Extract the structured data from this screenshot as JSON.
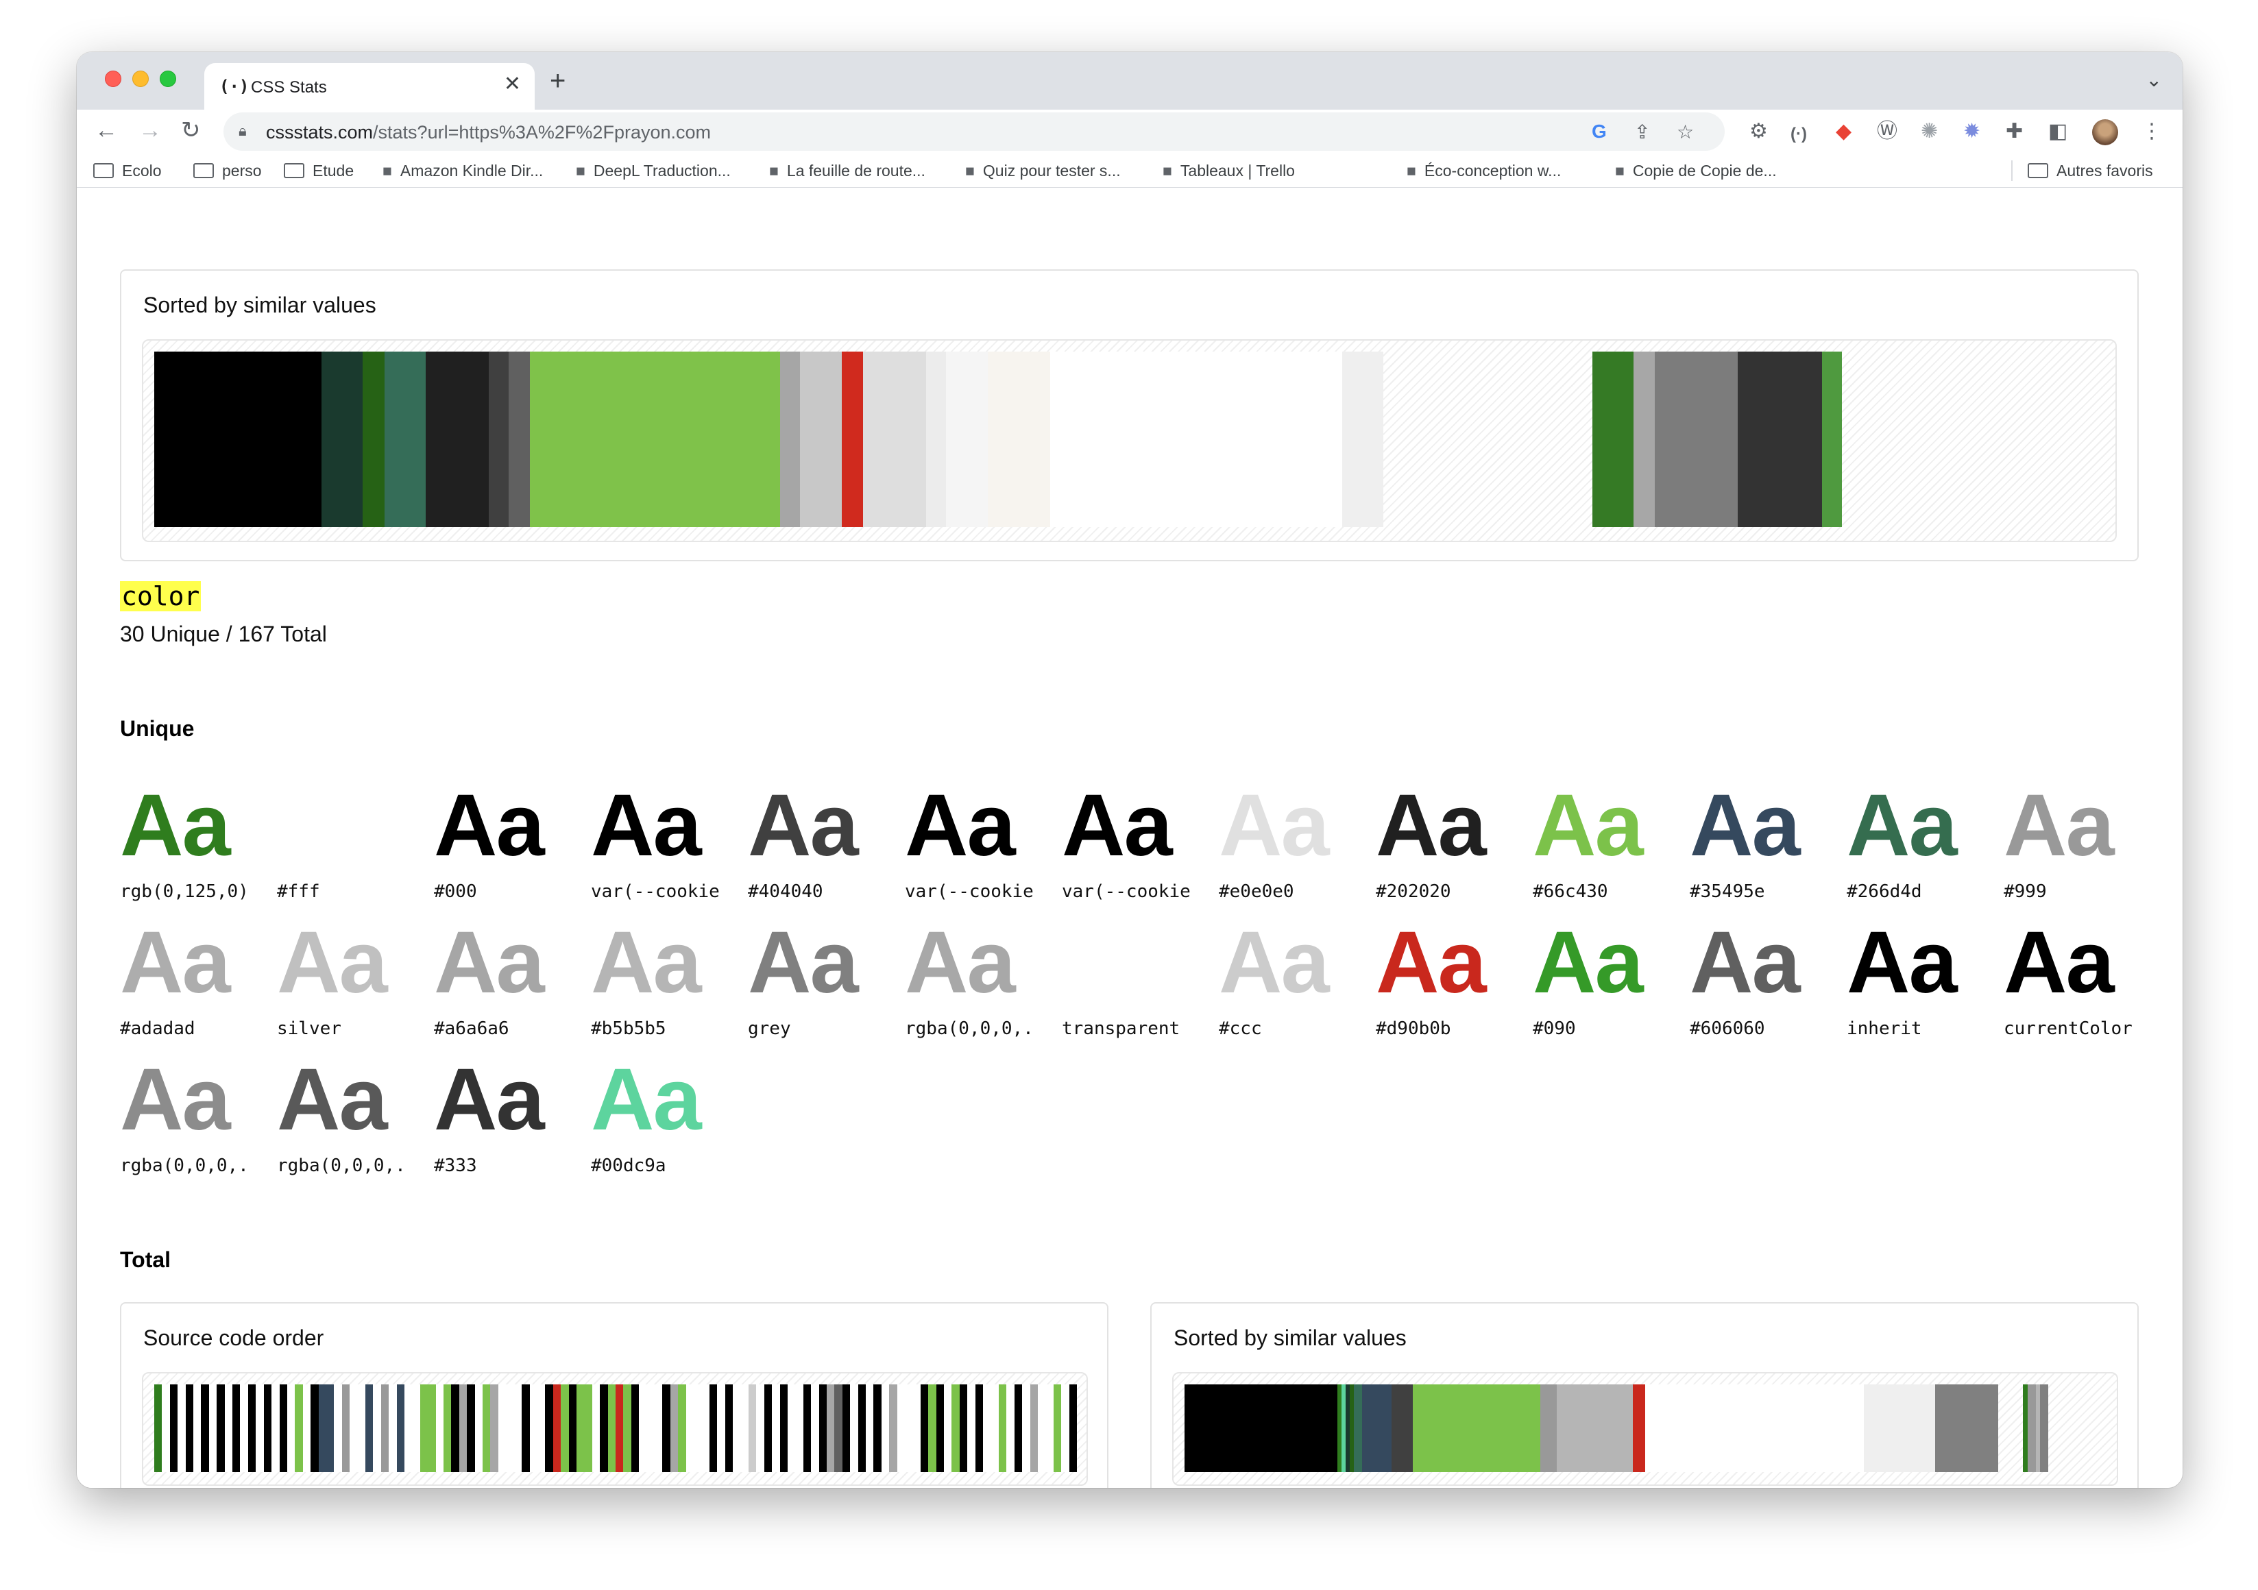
{
  "browser": {
    "tab_title": "CSS Stats",
    "tab_favicon": "(·)",
    "close_glyph": "✕",
    "newtab_glyph": "+",
    "url_host": "cssstats.com",
    "url_rest": "/stats?url=https%3A%2F%2Fprayon.com",
    "bookmarks": [
      {
        "label": "Ecolo",
        "icon": "folder-icon"
      },
      {
        "label": "perso",
        "icon": "folder-icon"
      },
      {
        "label": "Etude",
        "icon": "folder-icon"
      },
      {
        "label": "Amazon Kindle Dir...",
        "icon": "amazon-icon"
      },
      {
        "label": "DeepL Traduction...",
        "icon": "deepl-icon"
      },
      {
        "label": "La feuille de route...",
        "icon": "app-icon"
      },
      {
        "label": "Quiz pour tester s...",
        "icon": "quiz-icon"
      },
      {
        "label": "Tableaux | Trello",
        "icon": "trello-icon"
      },
      {
        "label": "Éco-conception w...",
        "icon": "slash-icon"
      },
      {
        "label": "Copie de Copie de...",
        "icon": "canva-icon"
      }
    ],
    "other_bookmarks": "Autres favoris"
  },
  "top_card": {
    "title": "Sorted by similar values",
    "strip": [
      {
        "color": "#000000",
        "weight": 117
      },
      {
        "color": "#1a3a2e",
        "weight": 29
      },
      {
        "color": "#266215",
        "weight": 15
      },
      {
        "color": "#356d58",
        "weight": 29
      },
      {
        "color": "#202020",
        "weight": 44
      },
      {
        "color": "#404040",
        "weight": 14
      },
      {
        "color": "#606060",
        "weight": 15
      },
      {
        "color": "#7fc24a",
        "weight": 175
      },
      {
        "color": "#a6a6a6",
        "weight": 14
      },
      {
        "color": "#c8c8c8",
        "weight": 29
      },
      {
        "color": "#d02a1e",
        "weight": 15
      },
      {
        "color": "#dedede",
        "weight": 44
      },
      {
        "color": "#ececec",
        "weight": 14
      },
      {
        "color": "#f5f5f5",
        "weight": 29
      },
      {
        "color": "#f7f4ef",
        "weight": 44
      },
      {
        "color": "#ffffff",
        "weight": 204
      },
      {
        "color": "#efefef",
        "weight": 29
      },
      {
        "color": "transparent",
        "weight": 146
      },
      {
        "color": "#357a25",
        "weight": 29
      },
      {
        "color": "#a7a7a7",
        "weight": 15
      },
      {
        "color": "#7c7c7c",
        "weight": 58
      },
      {
        "color": "#333333",
        "weight": 59
      },
      {
        "color": "#4f9a3f",
        "weight": 14
      },
      {
        "color": "transparent",
        "weight": 184
      }
    ]
  },
  "property": {
    "name": "color",
    "stats": "30 Unique / 167 Total"
  },
  "unique": {
    "heading": "Unique",
    "sample_text": "Aa",
    "items": [
      {
        "label": "rgb(0,125,0)",
        "color": "#2f7d1e"
      },
      {
        "label": "#fff",
        "color": "#ffffff"
      },
      {
        "label": "#000",
        "color": "#000000"
      },
      {
        "label": "var(--cookie",
        "color": "#000000"
      },
      {
        "label": "#404040",
        "color": "#404040"
      },
      {
        "label": "var(--cookie",
        "color": "#000000"
      },
      {
        "label": "var(--cookie",
        "color": "#000000"
      },
      {
        "label": "#e0e0e0",
        "color": "#e0e0e0"
      },
      {
        "label": "#202020",
        "color": "#202020"
      },
      {
        "label": "#66c430",
        "color": "#7cc24a"
      },
      {
        "label": "#35495e",
        "color": "#35495e"
      },
      {
        "label": "#266d4d",
        "color": "#356d4f"
      },
      {
        "label": "#999",
        "color": "#999999"
      },
      {
        "label": "#adadad",
        "color": "#adadad"
      },
      {
        "label": "silver",
        "color": "#c0c0c0"
      },
      {
        "label": "#a6a6a6",
        "color": "#a6a6a6"
      },
      {
        "label": "#b5b5b5",
        "color": "#b5b5b5"
      },
      {
        "label": "grey",
        "color": "#808080"
      },
      {
        "label": "rgba(0,0,0,.",
        "color": "#a8a8a8"
      },
      {
        "label": "transparent",
        "color": "transparent"
      },
      {
        "label": "#ccc",
        "color": "#cccccc"
      },
      {
        "label": "#d90b0b",
        "color": "#c9281d"
      },
      {
        "label": "#090",
        "color": "#359a28"
      },
      {
        "label": "#606060",
        "color": "#606060"
      },
      {
        "label": "inherit",
        "color": "#000000"
      },
      {
        "label": "currentColor",
        "color": "#000000"
      },
      {
        "label": "rgba(0,0,0,.",
        "color": "#8c8c8c"
      },
      {
        "label": "rgba(0,0,0,.",
        "color": "#595959"
      },
      {
        "label": "#333",
        "color": "#333333"
      },
      {
        "label": "#00dc9a",
        "color": "#5dd49e"
      }
    ]
  },
  "total": {
    "heading": "Total",
    "source_title": "Source code order",
    "sorted_title": "Sorted by similar values",
    "source_strip": [
      "#2f7d1e",
      "#ffffff",
      "#000000",
      "#ffffff",
      "#000000",
      "#ffffff",
      "#000000",
      "#ffffff",
      "#000000",
      "#ffffff",
      "#000000",
      "#ffffff",
      "#000000",
      "#ffffff",
      "#000000",
      "#ffffff",
      "#000000",
      "#ffffff",
      "#7cc24a",
      "#ffffff",
      "#000000",
      "#35495e",
      "#35495e",
      "#ffffff",
      "#999999",
      "#ffffff",
      "#ffffff",
      "#35495e",
      "#ffffff",
      "#999999",
      "#ffffff",
      "#35495e",
      "#ffffff",
      "#ffffff",
      "#7cc24a",
      "#7cc24a",
      "#ffffff",
      "#7cc24a",
      "#000000",
      "#a6a6a6",
      "#000000",
      "#ffffff",
      "#7cc24a",
      "#a6a6a6",
      "#ffffff",
      "#ffffff",
      "#ffffff",
      "#000000",
      "#ffffff",
      "#ffffff",
      "#000000",
      "#c9281d",
      "#7cc24a",
      "#000000",
      "#7cc24a",
      "#7cc24a",
      "#ffffff",
      "#000000",
      "#7cc24a",
      "#c9281d",
      "#7cc24a",
      "#000000",
      "#ffffff",
      "#ffffff",
      "#ffffff",
      "#000000",
      "#a6a6a6",
      "#7cc24a",
      "#ffffff",
      "#ffffff",
      "#ffffff",
      "#000000",
      "#ffffff",
      "#000000",
      "#ffffff",
      "#ffffff",
      "#cccccc",
      "#ffffff",
      "#000000",
      "#ffffff",
      "#000000",
      "#ffffff",
      "#ffffff",
      "#000000",
      "#ffffff",
      "#000000",
      "#a6a6a6",
      "#606060",
      "#000000",
      "#ffffff",
      "#000000",
      "#ffffff",
      "#000000",
      "#ffffff",
      "#a6a6a6",
      "#ffffff",
      "#ffffff",
      "#ffffff",
      "#000000",
      "#7cc24a",
      "#000000",
      "#ffffff",
      "#7cc24a",
      "#000000",
      "#ffffff",
      "#000000",
      "#ffffff",
      "#ffffff",
      "#7cc24a",
      "#ffffff",
      "#000000",
      "#ffffff",
      "#a6a6a6",
      "#ffffff",
      "#ffffff",
      "#7cc24a",
      "#ffffff",
      "#000000"
    ],
    "sorted_strip": [
      {
        "color": "#000000",
        "weight": 218
      },
      {
        "color": "#2f7d1e",
        "weight": 6
      },
      {
        "color": "#5dd49e",
        "weight": 6
      },
      {
        "color": "#1a3a2e",
        "weight": 6
      },
      {
        "color": "#266215",
        "weight": 6
      },
      {
        "color": "#356d58",
        "weight": 12
      },
      {
        "color": "#35495e",
        "weight": 42
      },
      {
        "color": "#404040",
        "weight": 30
      },
      {
        "color": "#7cc24a",
        "weight": 182
      },
      {
        "color": "#999999",
        "weight": 24
      },
      {
        "color": "#b5b5b5",
        "weight": 108
      },
      {
        "color": "#c9281d",
        "weight": 18
      },
      {
        "color": "#ffffff",
        "weight": 312
      },
      {
        "color": "#efefef",
        "weight": 102
      },
      {
        "color": "#808080",
        "weight": 90
      },
      {
        "color": "transparent",
        "weight": 36
      },
      {
        "color": "#2f7d1e",
        "weight": 6
      },
      {
        "color": "#999999",
        "weight": 12
      },
      {
        "color": "#b5b5b5",
        "weight": 6
      },
      {
        "color": "#808080",
        "weight": 12
      },
      {
        "color": "transparent",
        "weight": 84
      }
    ]
  }
}
